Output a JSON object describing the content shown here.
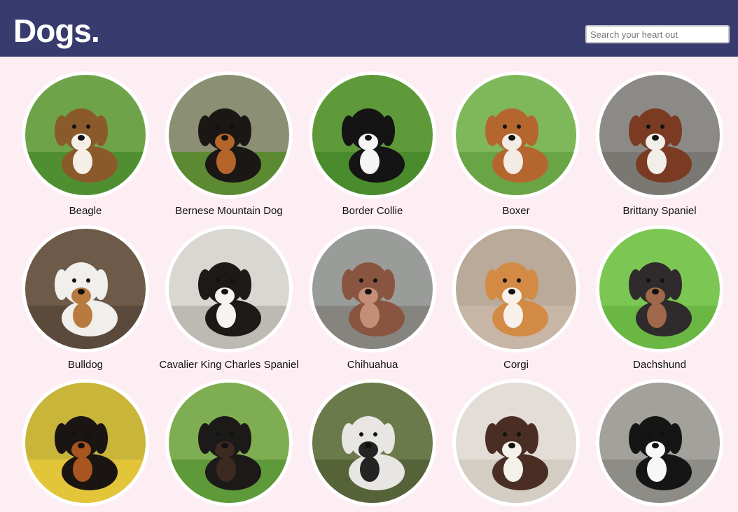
{
  "header": {
    "logo": "Dogs.",
    "search_placeholder": "Search your heart out",
    "bg_color": "#373b6e"
  },
  "page": {
    "bg_color": "#fdeef4"
  },
  "breeds": [
    {
      "name": "Beagle",
      "photo": {
        "bg": "#6fa34a",
        "ground": "#4f8f32",
        "fur": "#8a5a2b",
        "accent": "#f4f0e8"
      }
    },
    {
      "name": "Bernese Mountain Dog",
      "photo": {
        "bg": "#8b8f74",
        "ground": "#5c8a33",
        "fur": "#1b1714",
        "accent": "#b5652a"
      }
    },
    {
      "name": "Border Collie",
      "photo": {
        "bg": "#5e9a3a",
        "ground": "#4a8c2d",
        "fur": "#141414",
        "accent": "#f5f5f5"
      }
    },
    {
      "name": "Boxer",
      "photo": {
        "bg": "#7fb85a",
        "ground": "#6aa545",
        "fur": "#b5652e",
        "accent": "#f3ece4"
      }
    },
    {
      "name": "Brittany Spaniel",
      "photo": {
        "bg": "#8c8a86",
        "ground": "#7a7873",
        "fur": "#7a3b22",
        "accent": "#f2efea"
      }
    },
    {
      "name": "Bulldog",
      "photo": {
        "bg": "#6e5a48",
        "ground": "#5b4a3b",
        "fur": "#f1efec",
        "accent": "#b97a3f"
      }
    },
    {
      "name": "Cavalier King Charles Spaniel",
      "photo": {
        "bg": "#d9d7d2",
        "ground": "#bdbab3",
        "fur": "#1d1916",
        "accent": "#f6f4f0"
      }
    },
    {
      "name": "Chihuahua",
      "photo": {
        "bg": "#9a9c9a",
        "ground": "#86847f",
        "fur": "#8a5540",
        "accent": "#c58e76"
      }
    },
    {
      "name": "Corgi",
      "photo": {
        "bg": "#b9aa9a",
        "ground": "#c7b6a6",
        "fur": "#d28a44",
        "accent": "#f7f1ea"
      }
    },
    {
      "name": "Dachshund",
      "photo": {
        "bg": "#7cc653",
        "ground": "#6ab744",
        "fur": "#2f2b2c",
        "accent": "#a0684a"
      }
    },
    {
      "name": "",
      "photo": {
        "bg": "#c8b53a",
        "ground": "#e3c53a",
        "fur": "#1a1412",
        "accent": "#a8551f"
      }
    },
    {
      "name": "",
      "photo": {
        "bg": "#7fae52",
        "ground": "#5e9a3a",
        "fur": "#1c1a18",
        "accent": "#3c2a20"
      }
    },
    {
      "name": "",
      "photo": {
        "bg": "#6b7a4a",
        "ground": "#566339",
        "fur": "#e8e6e2",
        "accent": "#252424"
      }
    },
    {
      "name": "",
      "photo": {
        "bg": "#e2ddd6",
        "ground": "#d3cdc4",
        "fur": "#4a2e24",
        "accent": "#f4f0ea"
      }
    },
    {
      "name": "",
      "photo": {
        "bg": "#a3a19c",
        "ground": "#8e8c87",
        "fur": "#151515",
        "accent": "#f7f7f7"
      }
    }
  ]
}
